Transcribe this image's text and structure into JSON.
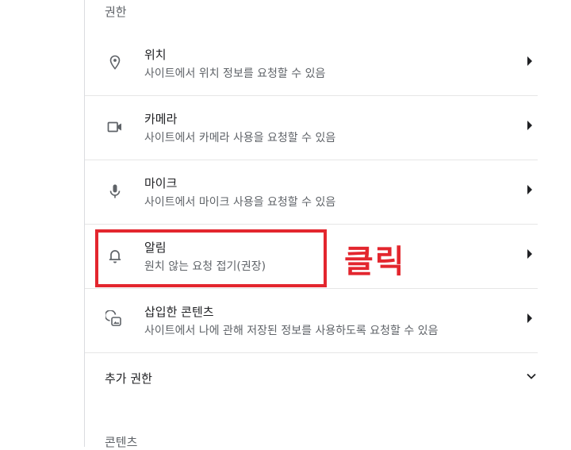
{
  "permissions_section": {
    "heading": "권한"
  },
  "permissions": [
    {
      "icon": "location-pin-icon",
      "title": "위치",
      "subtitle": "사이트에서 위치 정보를 요청할 수 있음"
    },
    {
      "icon": "camera-icon",
      "title": "카메라",
      "subtitle": "사이트에서 카메라 사용을 요청할 수 있음"
    },
    {
      "icon": "microphone-icon",
      "title": "마이크",
      "subtitle": "사이트에서 마이크 사용을 요청할 수 있음"
    },
    {
      "icon": "bell-icon",
      "title": "알림",
      "subtitle": "원치 않는 요청 접기(권장)"
    },
    {
      "icon": "embedded-content-icon",
      "title": "삽입한 콘텐츠",
      "subtitle": "사이트에서 나에 관해 저장된 정보를 사용하도록 요청할 수 있음"
    }
  ],
  "additional_permissions": {
    "label": "추가 권한",
    "icon": "chevron-down-icon"
  },
  "content_section": {
    "heading": "콘텐츠"
  },
  "annotation": {
    "text": "클릭",
    "color": "#e3262e"
  }
}
